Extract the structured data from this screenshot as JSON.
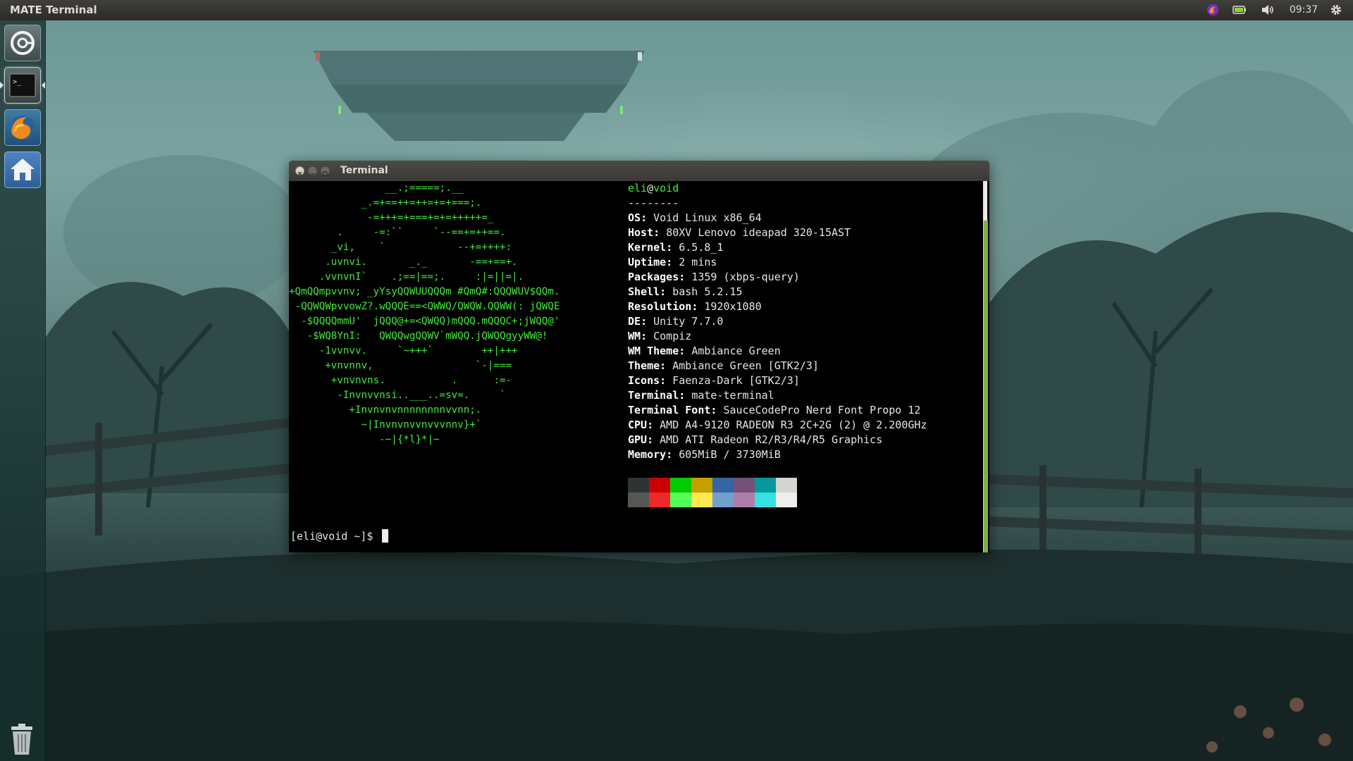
{
  "panel": {
    "app_title": "MATE Terminal",
    "clock": "09:37",
    "tray_icons": [
      "firefox-tray-icon",
      "battery-icon",
      "volume-icon",
      "gear-icon"
    ]
  },
  "launcher": {
    "items": [
      {
        "name": "dash",
        "icon": "dash-icon"
      },
      {
        "name": "terminal",
        "icon": "terminal-icon",
        "active": true
      },
      {
        "name": "firefox",
        "icon": "firefox-icon"
      },
      {
        "name": "home",
        "icon": "home-folder-icon"
      },
      {
        "name": "trash",
        "icon": "trash-icon"
      }
    ]
  },
  "window": {
    "title": "Terminal"
  },
  "terminal": {
    "user": "eli",
    "host": "void",
    "separator": "--------",
    "info": [
      {
        "key": "OS",
        "value": "Void Linux x86_64"
      },
      {
        "key": "Host",
        "value": "80XV Lenovo ideapad 320-15AST"
      },
      {
        "key": "Kernel",
        "value": "6.5.8_1"
      },
      {
        "key": "Uptime",
        "value": "2 mins"
      },
      {
        "key": "Packages",
        "value": "1359 (xbps-query)"
      },
      {
        "key": "Shell",
        "value": "bash 5.2.15"
      },
      {
        "key": "Resolution",
        "value": "1920x1080"
      },
      {
        "key": "DE",
        "value": "Unity 7.7.0"
      },
      {
        "key": "WM",
        "value": "Compiz"
      },
      {
        "key": "WM Theme",
        "value": "Ambiance Green"
      },
      {
        "key": "Theme",
        "value": "Ambiance Green [GTK2/3]"
      },
      {
        "key": "Icons",
        "value": "Faenza-Dark [GTK2/3]"
      },
      {
        "key": "Terminal",
        "value": "mate-terminal"
      },
      {
        "key": "Terminal Font",
        "value": "SauceCodePro Nerd Font Propo 12"
      },
      {
        "key": "CPU",
        "value": "AMD A4-9120 RADEON R3 2C+2G (2) @ 2.200GHz"
      },
      {
        "key": "GPU",
        "value": "AMD ATI Radeon R2/R3/R4/R5 Graphics"
      },
      {
        "key": "Memory",
        "value": "605MiB / 3730MiB"
      }
    ],
    "logo_lines": [
      "                __.;=====;.__",
      "            _.=+==++=++=+=+===;.",
      "             -=+++=+===+=+=+++++=_",
      "        .     -=:``     `--==+=++==.",
      "       _vi,    `            --+=++++:",
      "      .uvnvi.       _._       -==+==+.",
      "     .vvnvnI`    .;==|==;.     :|=||=|.",
      "+QmQQmpvvnv; _yYsyQQWUUQQQm #QmQ#:QQQWUV$QQm.",
      " -QQWQWpvvowZ?.wQQQE==<QWWQ/QWQW.QQWW(: jQWQE",
      "  -$QQQQmmU'  jQQQ@+=<QWQQ)mQQQ.mQQQC+;jWQQ@'",
      "   -$WQ8YnI:   QWQQwgQQWV`mWQQ.jQWQQgyyWW@!",
      "     -1vvnvv.     `~+++`        ++|+++",
      "      +vnvnnv,                 `-|===",
      "       +vnvnvns.           .      :=-",
      "        -Invnvvnsi..___..=sv=.     `",
      "          +Invnvnvnnnnnnnnvvnn;.",
      "            ~|Invnvnvvnvvvnnv}+`",
      "               -~|{*l}*|~"
    ],
    "palette": {
      "normal": [
        "#2e3436",
        "#cc0000",
        "#00cc00",
        "#c4a000",
        "#3465a4",
        "#75507b",
        "#06989a",
        "#d3d7cf"
      ],
      "bright": [
        "#555753",
        "#ef2929",
        "#55ff55",
        "#fce94f",
        "#729fcf",
        "#ad7fa8",
        "#34e2e2",
        "#eeeeec"
      ]
    },
    "prompt": "[eli@void ~]$ "
  }
}
